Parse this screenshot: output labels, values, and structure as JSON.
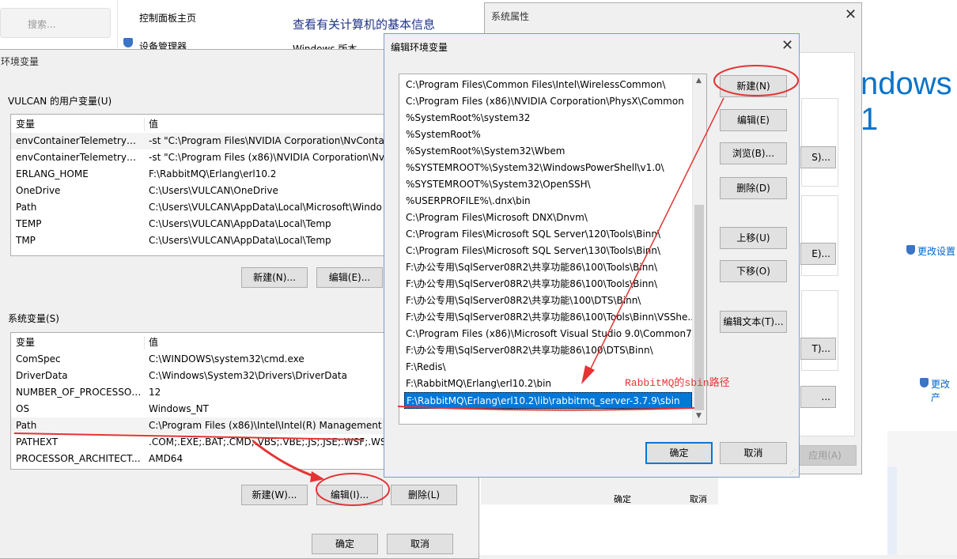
{
  "bg_control_panel": {
    "search_placeholder": "搜索...",
    "home_link": "控制面板主页",
    "device_manager": "设备管理器",
    "heading": "查看有关计算机的基本信息",
    "windows_edition_partial": "Windows 版本",
    "windows_logo_partial": "ndows 1",
    "change_settings": "更改设置",
    "change_product": "更改产",
    "confirm_partial": "确定",
    "cancel_partial": "取消"
  },
  "system_properties": {
    "title": "系统属性",
    "apply_label": "应用(A)",
    "btn_partial_1": "S)...",
    "btn_partial_2": "E)...",
    "btn_partial_3": "T)...",
    "btn_partial_4": "..."
  },
  "env_vars": {
    "title": "环境变量",
    "user_section": "VULCAN 的用户变量(U)",
    "system_section": "系统变量(S)",
    "col_var": "变量",
    "col_val": "值",
    "user_vars": [
      {
        "name": "envContainerTelemetryAp...",
        "value": "-st \"C:\\Program Files\\NVIDIA Corporation\\NvConta"
      },
      {
        "name": "envContainerTelemetryAp...",
        "value": "-st \"C:\\Program Files (x86)\\NVIDIA Corporation\\Nv"
      },
      {
        "name": "ERLANG_HOME",
        "value": "F:\\RabbitMQ\\Erlang\\erl10.2"
      },
      {
        "name": "OneDrive",
        "value": "C:\\Users\\VULCAN\\OneDrive"
      },
      {
        "name": "Path",
        "value": "C:\\Users\\VULCAN\\AppData\\Local\\Microsoft\\Windo"
      },
      {
        "name": "TEMP",
        "value": "C:\\Users\\VULCAN\\AppData\\Local\\Temp"
      },
      {
        "name": "TMP",
        "value": "C:\\Users\\VULCAN\\AppData\\Local\\Temp"
      }
    ],
    "system_vars": [
      {
        "name": "ComSpec",
        "value": "C:\\WINDOWS\\system32\\cmd.exe"
      },
      {
        "name": "DriverData",
        "value": "C:\\Windows\\System32\\Drivers\\DriverData"
      },
      {
        "name": "NUMBER_OF_PROCESSORS",
        "value": "12"
      },
      {
        "name": "OS",
        "value": "Windows_NT"
      },
      {
        "name": "Path",
        "value": "C:\\Program Files (x86)\\Intel\\Intel(R) Management E"
      },
      {
        "name": "PATHEXT",
        "value": ".COM;.EXE;.BAT;.CMD;.VBS;.VBE;.JS;.JSE;.WSF;.WSH;"
      },
      {
        "name": "PROCESSOR_ARCHITECT...",
        "value": "AMD64"
      }
    ],
    "user_new": "新建(N)...",
    "user_edit": "编辑(E)...",
    "sys_new": "新建(W)...",
    "sys_edit": "编辑(I)...",
    "sys_delete": "删除(L)",
    "ok": "确定",
    "cancel": "取消"
  },
  "edit_env": {
    "title": "编辑环境变量",
    "entries": [
      "C:\\Program Files\\Common Files\\Intel\\WirelessCommon\\",
      "C:\\Program Files (x86)\\NVIDIA Corporation\\PhysX\\Common",
      "%SystemRoot%\\system32",
      "%SystemRoot%",
      "%SystemRoot%\\System32\\Wbem",
      "%SYSTEMROOT%\\System32\\WindowsPowerShell\\v1.0\\",
      "%SYSTEMROOT%\\System32\\OpenSSH\\",
      "%USERPROFILE%\\.dnx\\bin",
      "C:\\Program Files\\Microsoft DNX\\Dnvm\\",
      "C:\\Program Files\\Microsoft SQL Server\\120\\Tools\\Binn\\",
      "C:\\Program Files\\Microsoft SQL Server\\130\\Tools\\Binn\\",
      "F:\\办公专用\\SqlServer08R2\\共享功能86\\100\\Tools\\Binn\\",
      "F:\\办公专用\\SqlServer08R2\\共享功能86\\100\\Tools\\Binn\\",
      "F:\\办公专用\\SqlServer08R2\\共享功能\\100\\DTS\\Binn\\",
      "F:\\办公专用\\SqlServer08R2\\共享功能86\\100\\Tools\\Binn\\VSShe...",
      "C:\\Program Files (x86)\\Microsoft Visual Studio 9.0\\Common7...",
      "F:\\办公专用\\SqlServer08R2\\共享功能86\\100\\DTS\\Binn\\",
      "F:\\Redis\\",
      "F:\\RabbitMQ\\Erlang\\erl10.2\\bin",
      "F:\\RabbitMQ\\Erlang\\erl10.2\\lib\\rabbitmq_server-3.7.9\\sbin"
    ],
    "selected_index": 19,
    "new": "新建(N)",
    "edit": "编辑(E)",
    "browse": "浏览(B)...",
    "delete": "删除(D)",
    "move_up": "上移(U)",
    "move_down": "下移(O)",
    "edit_text": "编辑文本(T)...",
    "ok": "确定",
    "cancel": "取消"
  },
  "annotation": {
    "text": "RabbitMQ的sbin路径",
    "color": "#e53333"
  }
}
